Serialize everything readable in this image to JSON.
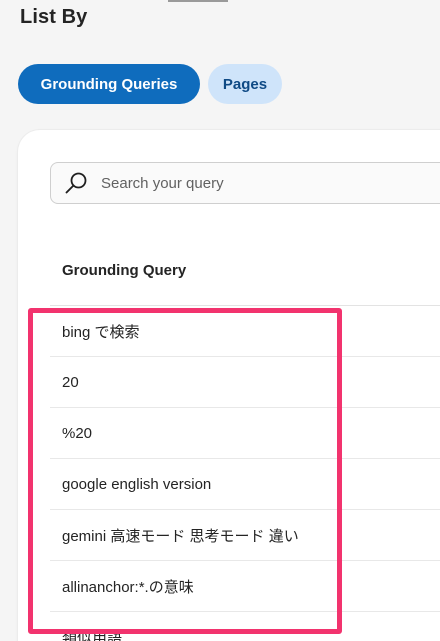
{
  "header": {
    "title": "List By"
  },
  "tabs": [
    {
      "label": "Grounding Queries",
      "active": true
    },
    {
      "label": "Pages",
      "active": false
    }
  ],
  "search": {
    "placeholder": "Search your query",
    "value": ""
  },
  "table": {
    "column_header": "Grounding Query",
    "rows": [
      "bing で検索",
      "20",
      "%20",
      "google english version",
      "gemini 高速モード 思考モード 違い",
      "allinanchor:*.の意味",
      "類似用語"
    ]
  },
  "colors": {
    "primary": "#0f6cbd",
    "secondary_pill": "#cfe4fa",
    "highlight": "#f2336e",
    "background": "#f5f5f5"
  },
  "icons": {
    "search": "search-icon"
  }
}
